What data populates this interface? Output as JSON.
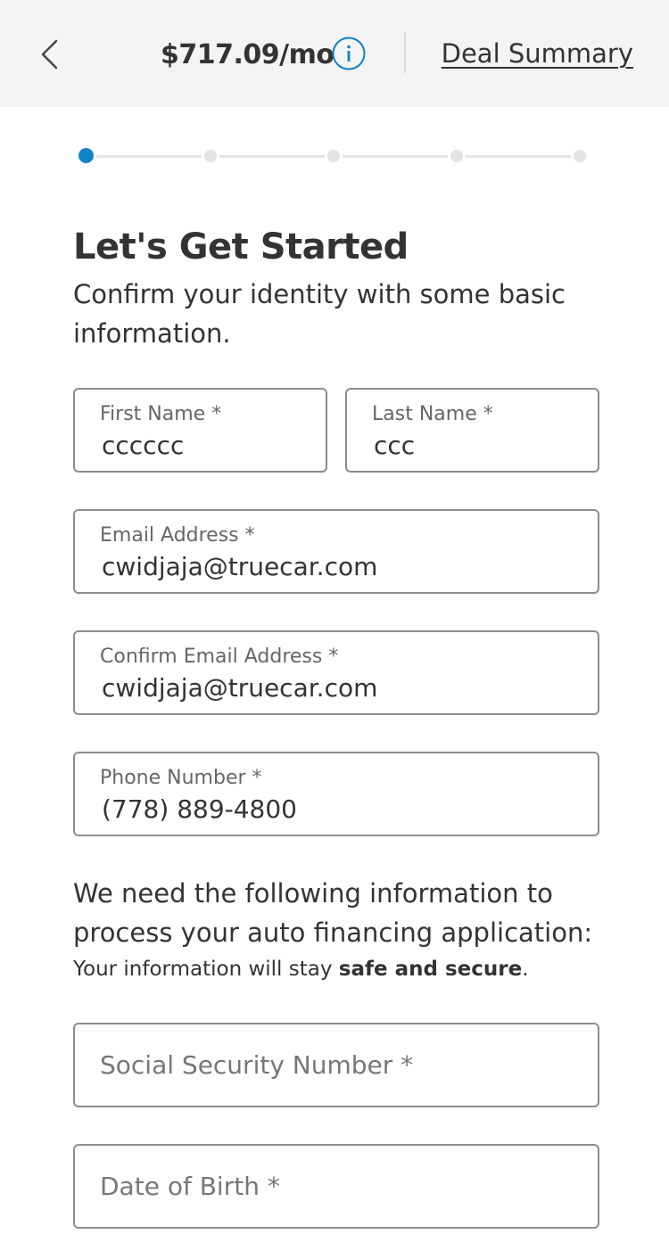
{
  "header": {
    "monthly_payment": "$717.09/mo",
    "deal_summary_label": "Deal Summary",
    "back_icon": "chevron-left-icon",
    "info_icon": "info-icon"
  },
  "stepper": {
    "total_steps": 5,
    "current_step": 1,
    "active_color": "#0d83c8",
    "inactive_color": "#e4e4e4"
  },
  "page": {
    "title": "Let's Get Started",
    "subtitle": "Confirm your identity with some basic information."
  },
  "form": {
    "first_name": {
      "label": "First Name *",
      "value": "cccccc"
    },
    "last_name": {
      "label": "Last Name *",
      "value": "ccc"
    },
    "email": {
      "label": "Email Address *",
      "value": "cwidjaja@truecar.com"
    },
    "confirm_email": {
      "label": "Confirm Email Address *",
      "value": "cwidjaja@truecar.com"
    },
    "phone": {
      "label": "Phone Number *",
      "value": "(778) 889-4800"
    },
    "ssn": {
      "placeholder": "Social Security Number *",
      "value": ""
    },
    "dob": {
      "placeholder": "Date of Birth *",
      "value": ""
    }
  },
  "financing": {
    "intro": "We need the following information to process your auto financing application:",
    "safe_prefix": "Your information will stay ",
    "safe_bold": "safe and secure",
    "safe_suffix": "."
  }
}
